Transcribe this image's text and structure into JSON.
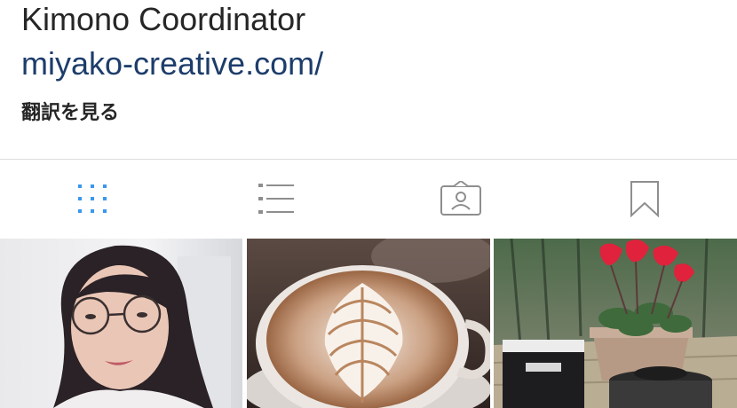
{
  "profile": {
    "name": "Kimono Coordinator",
    "website": "miyako-creative.com/",
    "translate_label": "翻訳を見る"
  },
  "tabs": [
    {
      "id": "grid",
      "icon": "grid-icon",
      "active": true
    },
    {
      "id": "list",
      "icon": "list-icon",
      "active": false
    },
    {
      "id": "tagged",
      "icon": "tagged-person-icon",
      "active": false
    },
    {
      "id": "saved",
      "icon": "bookmark-icon",
      "active": false
    }
  ],
  "posts": [
    {
      "subject": "portrait-photo",
      "alt": "woman with round glasses"
    },
    {
      "subject": "latte-art-photo",
      "alt": "latte with leaf art"
    },
    {
      "subject": "flower-tea-photo",
      "alt": "red cyclamen and tea tin"
    }
  ],
  "colors": {
    "accent": "#3897f0",
    "link": "#1d3d6b",
    "icon_inactive": "#8e8e8e",
    "divider": "#dbdbdb"
  }
}
